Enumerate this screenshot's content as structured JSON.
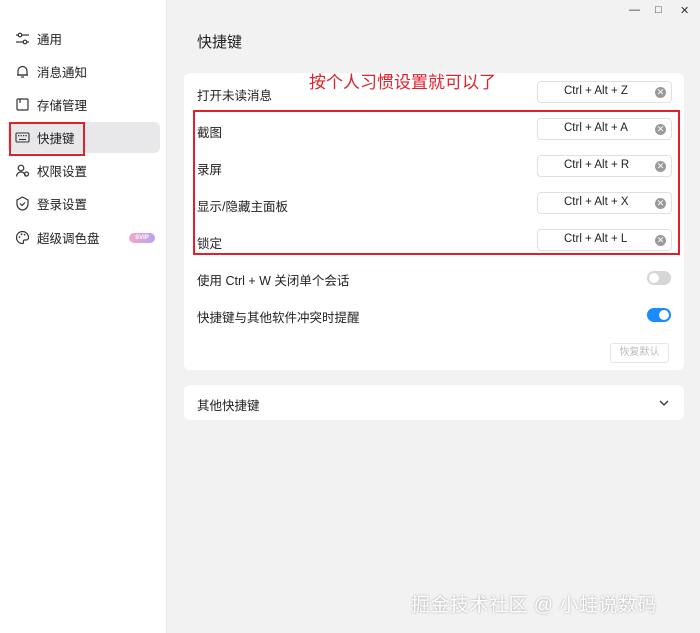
{
  "window": {
    "minimize_icon": "—",
    "maximize_icon": "□",
    "close_icon": "✕"
  },
  "sidebar": {
    "items": [
      {
        "label": "通用",
        "icon": "sliders-icon"
      },
      {
        "label": "消息通知",
        "icon": "bell-icon"
      },
      {
        "label": "存储管理",
        "icon": "storage-icon"
      },
      {
        "label": "快捷键",
        "icon": "keyboard-icon",
        "active": true
      },
      {
        "label": "权限设置",
        "icon": "user-permission-icon"
      },
      {
        "label": "登录设置",
        "icon": "shield-icon"
      },
      {
        "label": "超级调色盘",
        "icon": "palette-icon",
        "badge": "SVIP"
      }
    ]
  },
  "main": {
    "title": "快捷键",
    "annotation": "按个人习惯设置就可以了",
    "shortcuts": [
      {
        "label": "打开未读消息",
        "keys": "Ctrl + Alt + Z"
      },
      {
        "label": "截图",
        "keys": "Ctrl + Alt + A"
      },
      {
        "label": "录屏",
        "keys": "Ctrl + Alt + R"
      },
      {
        "label": "显示/隐藏主面板",
        "keys": "Ctrl + Alt + X"
      },
      {
        "label": "锁定",
        "keys": "Ctrl + Alt + L"
      }
    ],
    "toggles": [
      {
        "label": "使用 Ctrl + W 关闭单个会话",
        "on": false
      },
      {
        "label": "快捷键与其他软件冲突时提醒",
        "on": true
      }
    ],
    "restore_label": "恢复默认",
    "other_label": "其他快捷键"
  },
  "watermark": "掘金技术社区 @ 小蛙说数码",
  "colors": {
    "accent": "#1a8cff",
    "annotation_red": "#e0202a",
    "toggle_off": "#d6d6d6"
  }
}
